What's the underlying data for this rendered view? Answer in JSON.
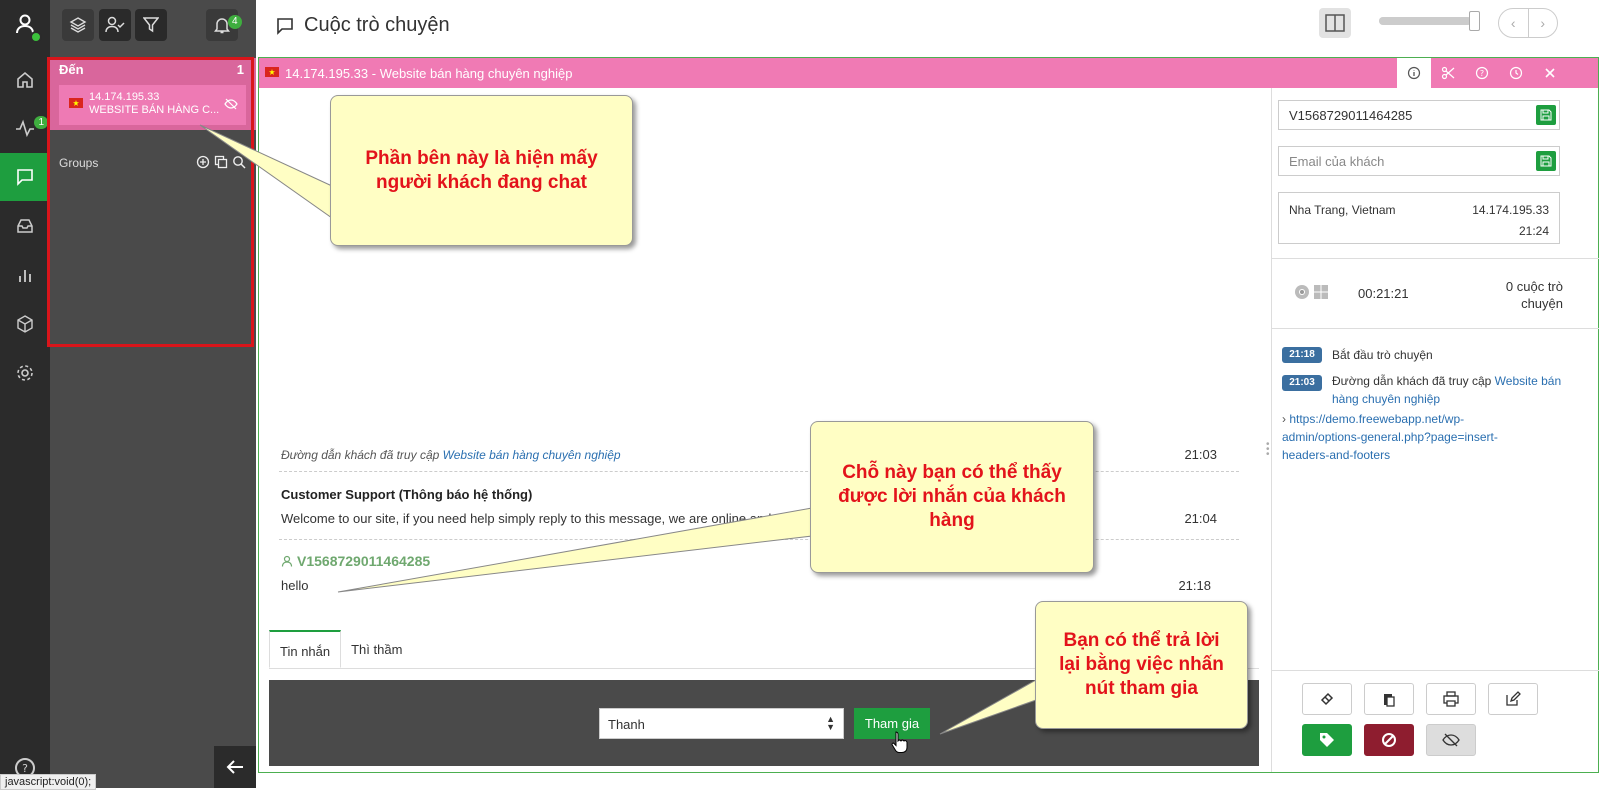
{
  "app": {
    "page_title": "Cuộc trò chuyện",
    "status_url": "javascript:void(0);",
    "rail_badge": "1",
    "notifications_count": "4"
  },
  "sidebar": {
    "incoming_label": "Đến",
    "incoming_count": "1",
    "chat_item": {
      "ip": "14.174.195.33",
      "site": "WEBSITE BÁN HÀNG C..."
    },
    "groups_label": "Groups"
  },
  "chat": {
    "title": "14.174.195.33 - Website bán hàng chuyên nghiệp",
    "messages": [
      {
        "type": "system",
        "text_prefix": "Đường dẫn khách đã truy cập",
        "link": "Website bán hàng chuyên nghiệp",
        "time": "21:03"
      },
      {
        "type": "support",
        "author": "Customer Support (Thông báo hệ thống)",
        "text": "Welcome to our site, if you need help simply reply to this message, we are online and ready to",
        "time": "21:04"
      },
      {
        "type": "visitor",
        "author": "V1568729011464285",
        "text": "hello",
        "time": "21:18"
      }
    ],
    "tabs": [
      "Tin nhắn",
      "Thì thầm"
    ],
    "operator_select": "Thanh",
    "join_button": "Tham gia"
  },
  "info": {
    "visitor_id": "V1568729011464285",
    "email_placeholder": "Email của khách",
    "location": "Nha Trang, Vietnam",
    "ip": "14.174.195.33",
    "local_time": "21:24",
    "duration": "00:21:21",
    "chats_count_line1": "0 cuộc trò",
    "chats_count_line2": "chuyện",
    "events": [
      {
        "time": "21:18",
        "text": "Bắt đầu trò chuyện"
      },
      {
        "time": "21:03",
        "text": "Đường dẫn khách đã truy cập",
        "link": "Website bán hàng chuyên nghiệp"
      }
    ],
    "url_line1": "https://demo.freewebapp.net/wp-",
    "url_line2": "admin/options-general.php?page=insert-",
    "url_line3": "headers-and-footers"
  },
  "callouts": {
    "left_line1": "Phần bên này là hiện mấy",
    "left_line2": "người khách đang chat",
    "middle_line1": "Chỗ này bạn có thể thấy",
    "middle_line2": "được lời nhắn của khách",
    "middle_line3": "hàng",
    "right_line1": "Bạn có thể trả lời",
    "right_line2": "lại bằng việc nhấn",
    "right_line3": "nút tham gia"
  },
  "colors": {
    "accent_green": "#1e9e3f",
    "chat_pink": "#f07ab4",
    "highlight_red": "#d9151b",
    "callout_bg": "#fffec4",
    "callout_text": "#e3131b"
  }
}
